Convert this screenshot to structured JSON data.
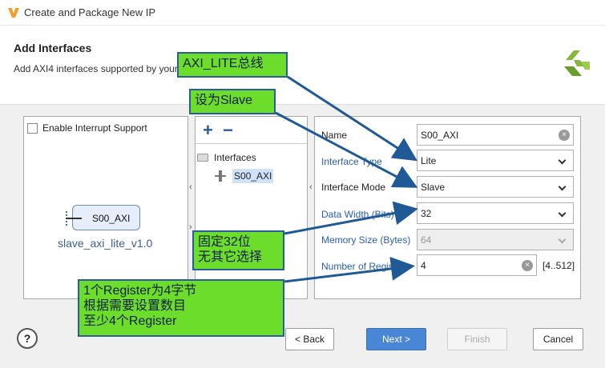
{
  "window": {
    "title": "Create and Package New IP"
  },
  "header": {
    "title": "Add Interfaces",
    "subtitle": "Add AXI4 interfaces supported by your"
  },
  "left_panel": {
    "interrupt_label": "Enable Interrupt Support",
    "block_name": "S00_AXI",
    "block_caption": "slave_axi_lite_v1.0"
  },
  "mid_panel": {
    "add_label": "+",
    "remove_label": "−",
    "tree_root": "Interfaces",
    "tree_item": "S00_AXI"
  },
  "form": {
    "name_label": "Name",
    "name_value": "S00_AXI",
    "type_label": "Interface Type",
    "type_value": "Lite",
    "mode_label": "Interface Mode",
    "mode_value": "Slave",
    "width_label": "Data Width (Bits)",
    "width_value": "32",
    "memsize_label": "Memory Size (Bytes)",
    "memsize_value": "64",
    "numreg_label": "Number of Registers",
    "numreg_value": "4",
    "numreg_range": "[4..512]"
  },
  "annotations": {
    "c1": "AXI_LITE总线",
    "c2": "设为Slave",
    "c3_line1": "固定32位",
    "c3_line2": "无其它选择",
    "c4_line1": "1个Register为4字节",
    "c4_line2": "根据需要设置数目",
    "c4_line3": "至少4个Register"
  },
  "buttons": {
    "help": "?",
    "back": "< Back",
    "next": "Next >",
    "finish": "Finish",
    "cancel": "Cancel"
  },
  "colors": {
    "callout_fill": "#6cdd2a",
    "callout_border": "#2a5d9b",
    "arrow": "#1f5a96",
    "logo": "#86b83a",
    "field_label_blue": "#2a5db0"
  }
}
